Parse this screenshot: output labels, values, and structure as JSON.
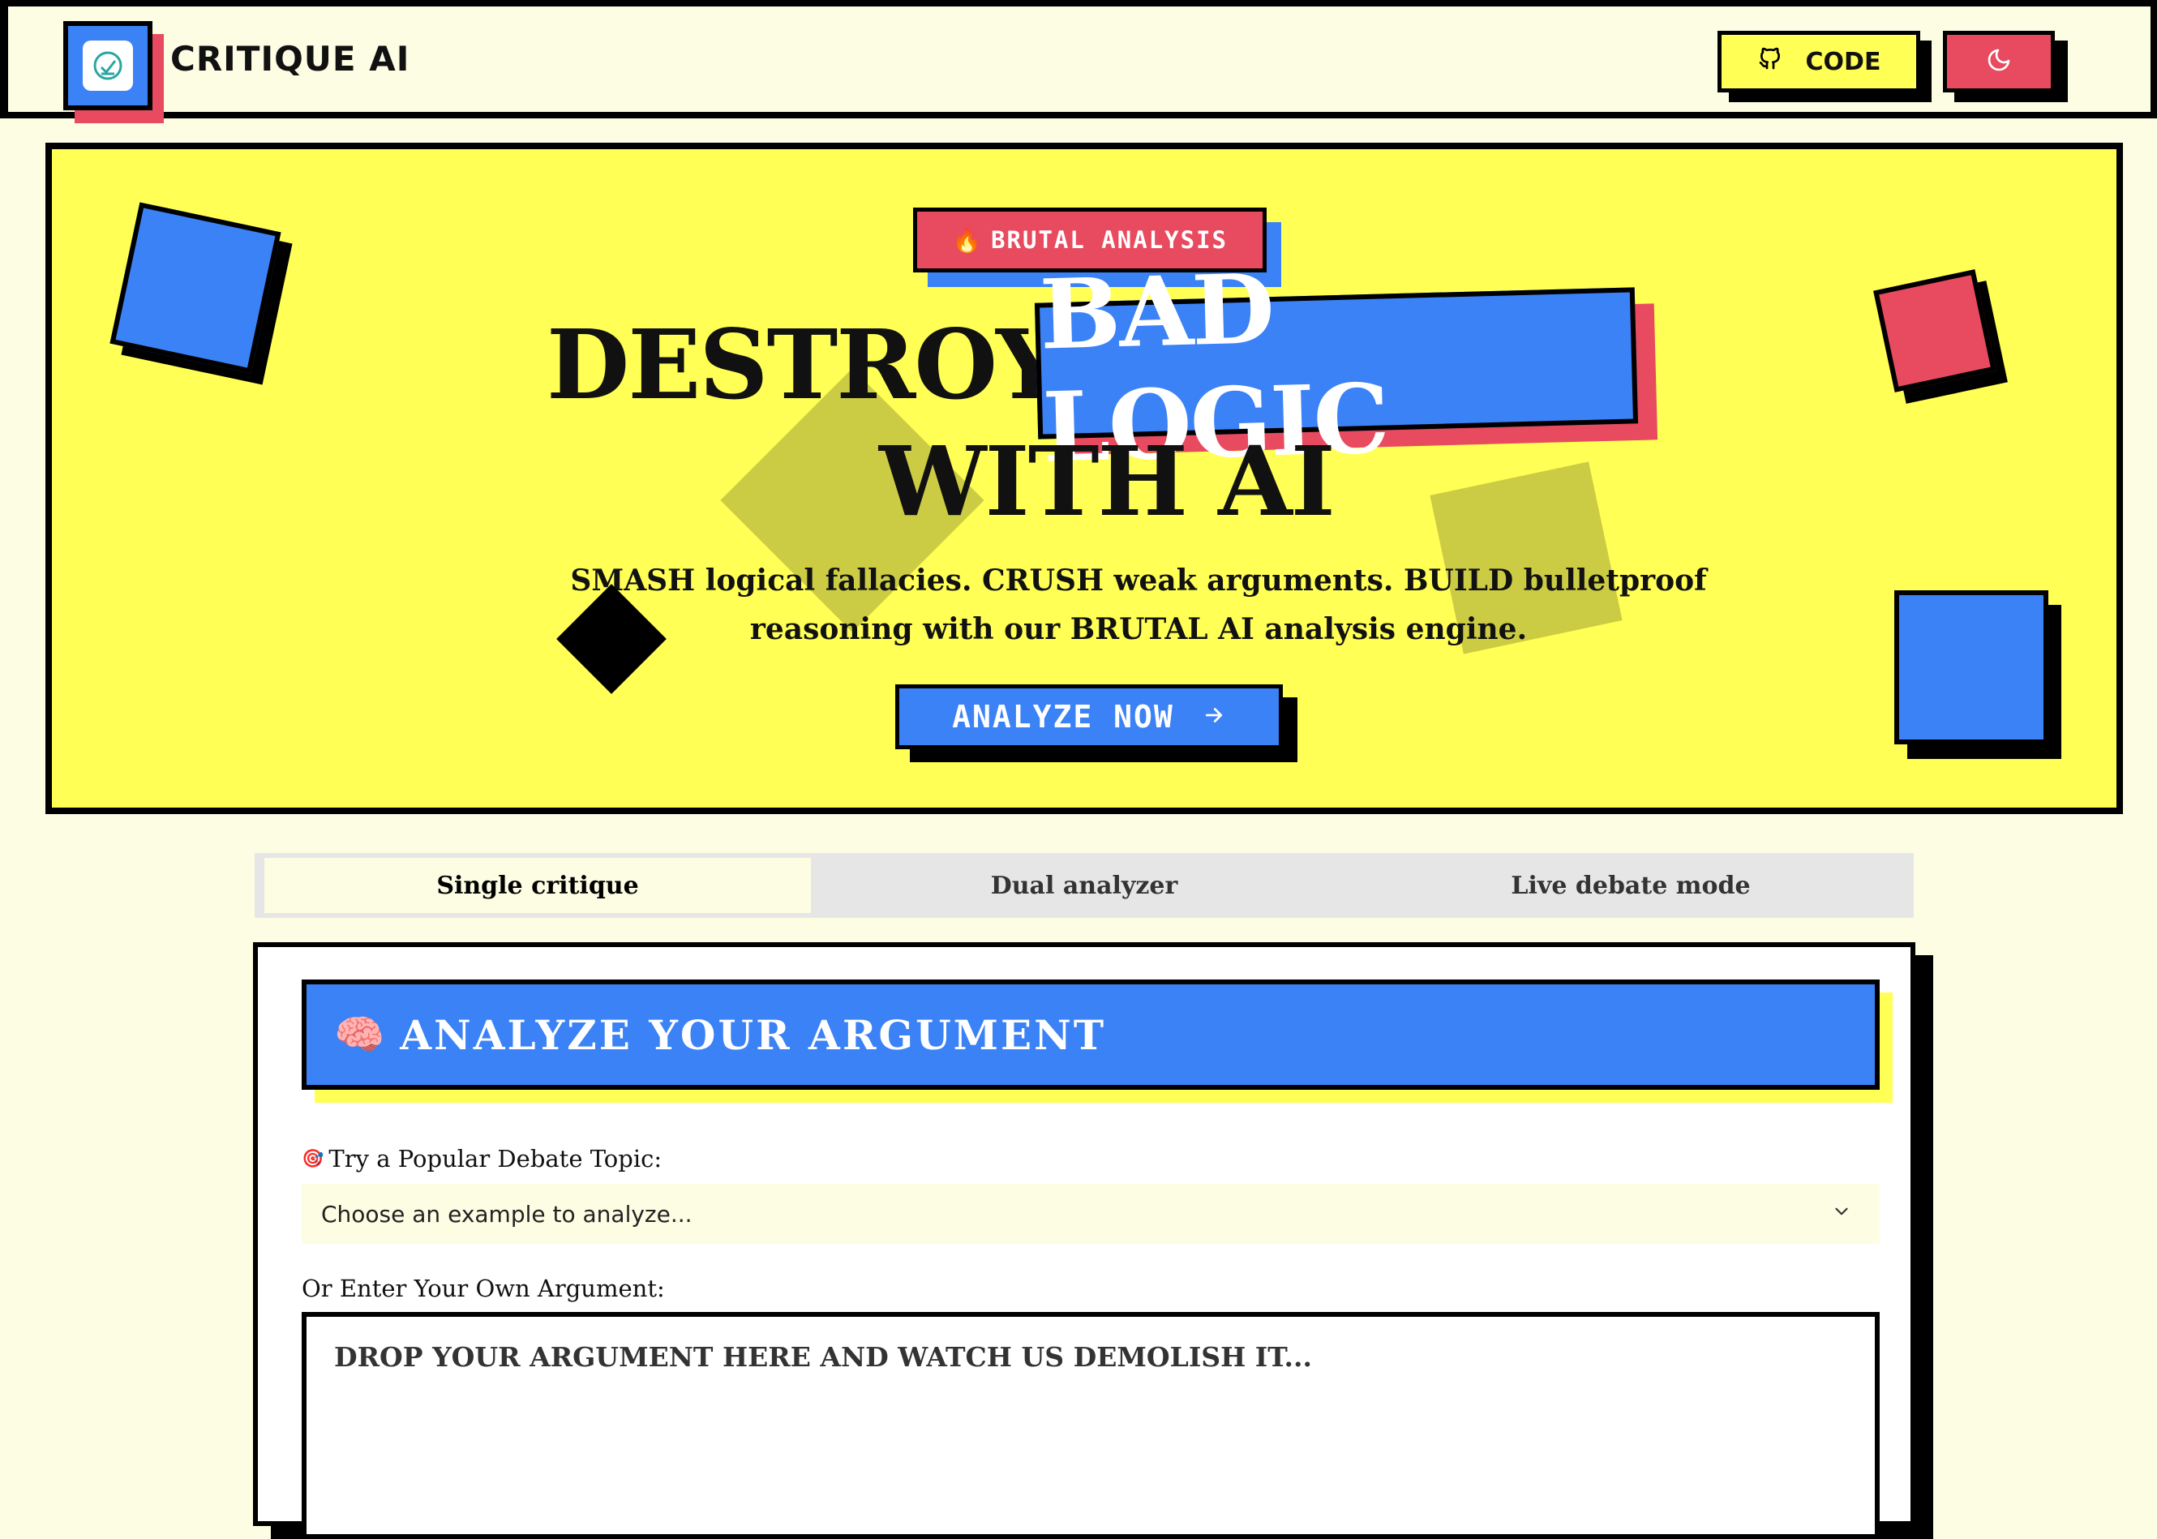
{
  "header": {
    "brand": "CRITIQUE AI",
    "code_label": "CODE",
    "icons": {
      "logo": "logo-check-icon",
      "code": "github-icon",
      "theme": "moon-icon"
    }
  },
  "hero": {
    "badge": {
      "emoji": "🔥",
      "label": "BRUTAL ANALYSIS"
    },
    "title_part1": "DESTROY",
    "title_highlight": "BAD LOGIC",
    "title_line2": "WITH AI",
    "subtitle_line1": "SMASH logical fallacies. CRUSH weak arguments. BUILD bulletproof",
    "subtitle_line2": "reasoning with our BRUTAL AI analysis engine.",
    "cta_label": "ANALYZE NOW",
    "cta_icon": "arrow-right-icon"
  },
  "tabs": [
    {
      "label": "Single critique",
      "active": true
    },
    {
      "label": "Dual analyzer",
      "active": false
    },
    {
      "label": "Live debate mode",
      "active": false
    }
  ],
  "card": {
    "heading_emoji": "🧠",
    "heading": "ANALYZE YOUR ARGUMENT",
    "topic_emoji": "🎯",
    "topic_label": "Try a Popular Debate Topic:",
    "topic_select_value": "Choose an example to analyze...",
    "own_label": "Or Enter Your Own Argument:",
    "argument_placeholder": "DROP YOUR ARGUMENT HERE AND WATCH US DEMOLISH IT...",
    "argument_value": ""
  },
  "colors": {
    "yellow": "#ffff55",
    "blue": "#3b82f6",
    "red": "#e84a5f",
    "olive": "#cccc44",
    "cream": "#fdfde4"
  }
}
